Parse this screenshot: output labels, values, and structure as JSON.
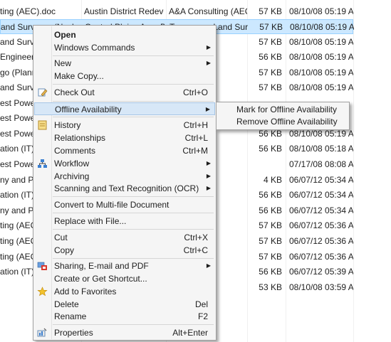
{
  "rows": [
    {
      "name": "ting (AEC).doc",
      "author": "Austin District Redevelo...",
      "company": "A&A Consulting (AEC)",
      "size": "57 KB",
      "date": "08/10/08 05:19 AM"
    },
    {
      "name": "and Surveyor (Nashville)",
      "author": "Central Plains Area Dev...",
      "company": "Tennessee Land Survey...",
      "size": "57 KB",
      "date": "08/10/08 05:19 AM"
    },
    {
      "name": "and Surveyo",
      "author": "",
      "company": "Survey...",
      "size": "57 KB",
      "date": "08/10/08 05:19 AM"
    },
    {
      "name": "Engineering",
      "author": "",
      "company": "neerin...",
      "size": "56 KB",
      "date": "08/10/08 05:19 AM"
    },
    {
      "name": "go (Plannin",
      "author": "",
      "company": "Planni...",
      "size": "57 KB",
      "date": "08/10/08 05:19 AM"
    },
    {
      "name": "and Surveyo",
      "author": "",
      "company": "Survey...",
      "size": "57 KB",
      "date": "08/10/08 05:19 AM"
    },
    {
      "name": "est Power.d",
      "author": "",
      "company": "",
      "size": "",
      "date": ""
    },
    {
      "name": "est Power.d",
      "author": "",
      "company": "",
      "size": "",
      "date": ""
    },
    {
      "name": "est Power.d",
      "author": "",
      "company": "Power",
      "size": "56 KB",
      "date": "08/10/08 05:19 AM"
    },
    {
      "name": "ation (IT).d",
      "author": "",
      "company": "n (IT)",
      "size": "56 KB",
      "date": "08/10/08 05:18 AM"
    },
    {
      "name": "est Power",
      "author": "",
      "company": "Power",
      "size": "",
      "date": "07/17/08 08:08 AM"
    },
    {
      "name": "ny and Part",
      "author": "",
      "company": "nd Part...",
      "size": "4 KB",
      "date": "06/07/12 05:34 AM"
    },
    {
      "name": "ation (IT).d",
      "author": "",
      "company": "n (IT)",
      "size": "56 KB",
      "date": "06/07/12 05:34 AM"
    },
    {
      "name": "ny and Part",
      "author": "",
      "company": "n Part...",
      "size": "56 KB",
      "date": "06/07/12 05:34 AM"
    },
    {
      "name": "ting (AEC).d",
      "author": "",
      "company": "(AEC)",
      "size": "57 KB",
      "date": "06/07/12 05:36 AM"
    },
    {
      "name": "ting (AEC).d",
      "author": "",
      "company": "(AEC)",
      "size": "57 KB",
      "date": "06/07/12 05:36 AM"
    },
    {
      "name": "ting (AEC).d",
      "author": "",
      "company": "(AEC)",
      "size": "57 KB",
      "date": "06/07/12 05:36 AM"
    },
    {
      "name": "ation (IT).d",
      "author": "",
      "company": "n (IT)",
      "size": "56 KB",
      "date": "06/07/12 05:39 AM"
    },
    {
      "name": "",
      "author": "",
      "company": "",
      "size": "53 KB",
      "date": "08/10/08 03:59 AM"
    }
  ],
  "menu": {
    "open": "Open",
    "windows_commands": "Windows Commands",
    "new": "New",
    "make_copy": "Make Copy...",
    "check_out": "Check Out",
    "check_out_sc": "Ctrl+O",
    "offline": "Offline Availability",
    "history": "History",
    "history_sc": "Ctrl+H",
    "relationships": "Relationships",
    "relationships_sc": "Ctrl+L",
    "comments": "Comments",
    "comments_sc": "Ctrl+M",
    "workflow": "Workflow",
    "archiving": "Archiving",
    "scanning": "Scanning and Text Recognition (OCR)",
    "convert": "Convert to Multi-file Document",
    "replace": "Replace with File...",
    "cut": "Cut",
    "cut_sc": "Ctrl+X",
    "copy": "Copy",
    "copy_sc": "Ctrl+C",
    "sharing": "Sharing, E-mail and PDF",
    "shortcut": "Create or Get Shortcut...",
    "favorites": "Add to Favorites",
    "delete": "Delete",
    "delete_sc": "Del",
    "rename": "Rename",
    "rename_sc": "F2",
    "properties": "Properties",
    "properties_sc": "Alt+Enter"
  },
  "submenu": {
    "mark": "Mark for Offline Availability",
    "remove": "Remove Offline Availability"
  },
  "icons": {
    "check_out": "pencil-icon",
    "history": "history-icon",
    "workflow": "workflow-icon",
    "sharing": "pdf-share-icon",
    "favorites": "star-icon",
    "properties": "properties-icon",
    "submenu": "chevron-right-icon"
  },
  "colors": {
    "selection_bg": "#cce8ff",
    "menu_highlight": "#d7e7f7",
    "menu_bg": "#f5f5f5"
  }
}
